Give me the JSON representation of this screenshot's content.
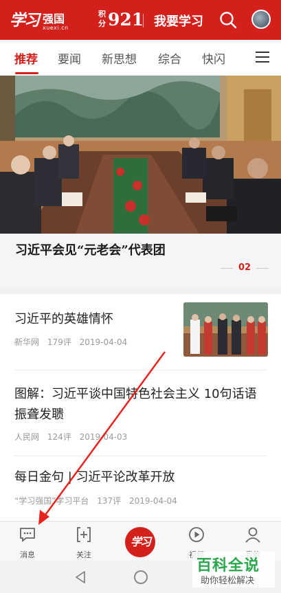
{
  "header": {
    "logo_text": "学习",
    "logo_text2": "强国",
    "logo_domain": "xuexi.cn",
    "points_label": "积分",
    "points_value": "921",
    "learn_button": "我要学习",
    "search_icon": "search-icon",
    "avatar_icon": "avatar"
  },
  "tabs": {
    "items": [
      {
        "label": "推荐",
        "active": true
      },
      {
        "label": "要闻",
        "active": false
      },
      {
        "label": "新思想",
        "active": false
      },
      {
        "label": "综合",
        "active": false
      },
      {
        "label": "快闪",
        "active": false
      }
    ],
    "menu_icon": "menu-icon"
  },
  "feature": {
    "title": "习近平会见“元老会”代表团",
    "slide_number": "02"
  },
  "news": [
    {
      "title": "习近平的英雄情怀",
      "source": "新华网",
      "comments": "179评",
      "date": "2019-04-04",
      "has_thumb": true
    },
    {
      "title": "图解：习近平谈中国特色社会主义 10句话语振聋发聩",
      "source": "人民网",
      "comments": "124评",
      "date": "2019-04-03"
    },
    {
      "title": "每日金句 | 习近平论改革开放",
      "source": "“学习强国”学习平台",
      "comments": "137评",
      "date": "2019-04-04"
    }
  ],
  "bottom_nav": {
    "items": [
      {
        "label": "消息",
        "icon": "message-icon"
      },
      {
        "label": "关注",
        "icon": "follow-icon"
      },
      {
        "label": "",
        "icon": "xuexi-logo"
      },
      {
        "label": "视频",
        "icon": "play-icon"
      },
      {
        "label": "我的",
        "icon": "user-icon"
      }
    ],
    "center_text": "学习"
  },
  "watermark": {
    "main": "百科全说",
    "sub": "助你轻松解决"
  },
  "colors": {
    "brand_red": "#d3201b",
    "watermark_green": "#2ba74b"
  }
}
